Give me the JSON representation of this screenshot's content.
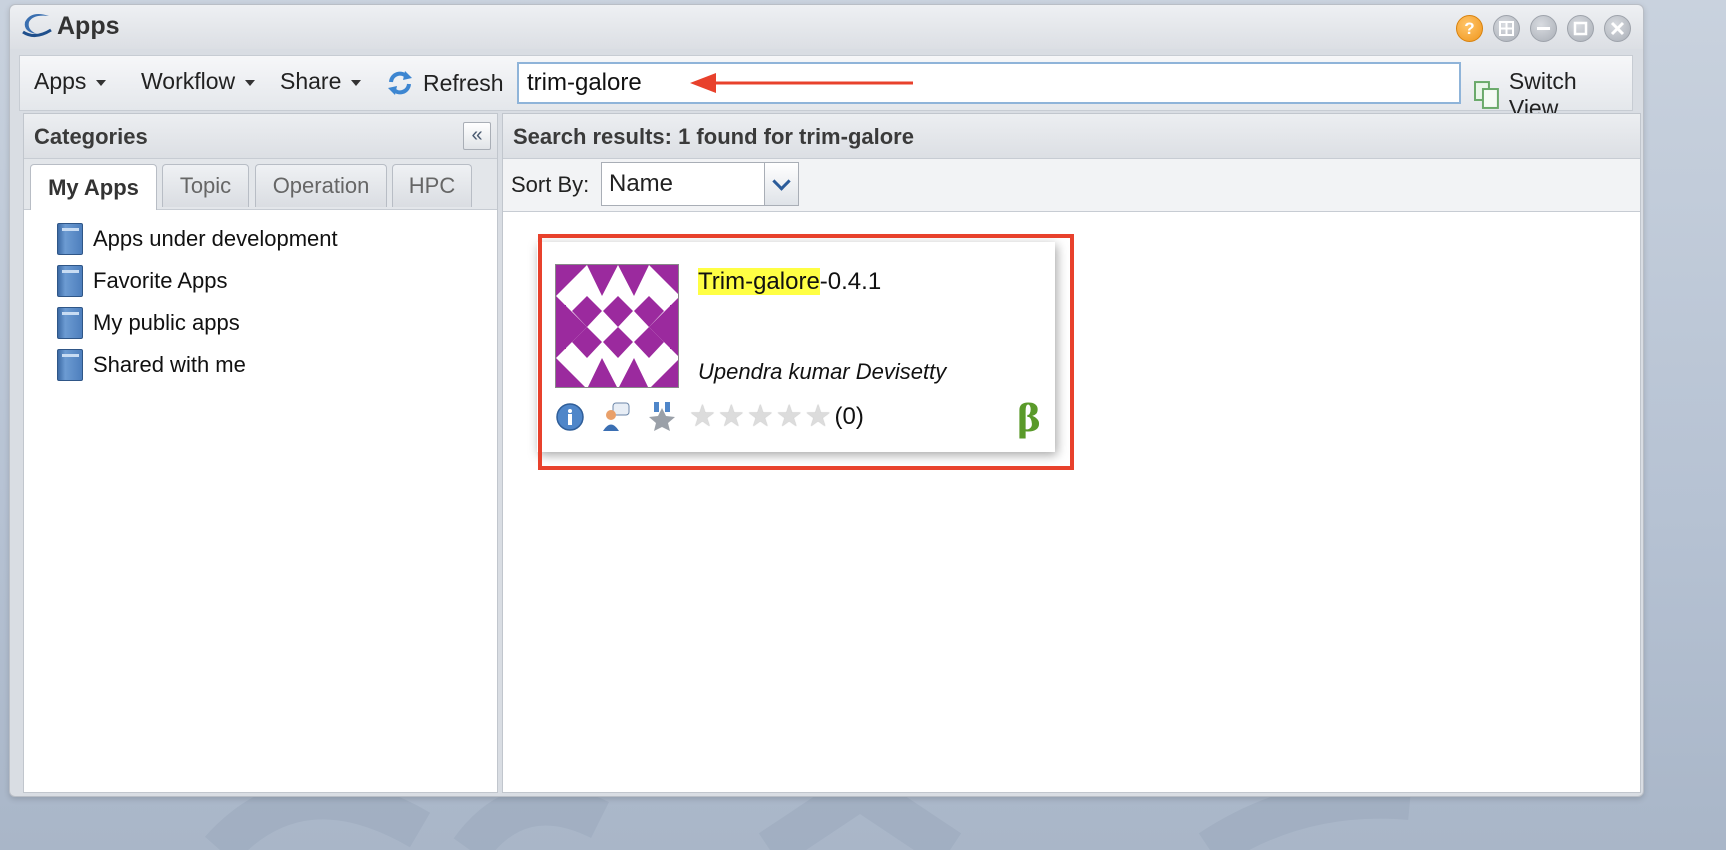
{
  "window": {
    "title": "Apps"
  },
  "toolbar": {
    "apps_label": "Apps",
    "workflow_label": "Workflow",
    "share_label": "Share",
    "refresh_label": "Refresh",
    "search_value": "trim-galore",
    "switch_view_label": "Switch View"
  },
  "categories": {
    "title": "Categories",
    "tabs": [
      {
        "label": "My Apps",
        "active": true
      },
      {
        "label": "Topic",
        "active": false
      },
      {
        "label": "Operation",
        "active": false
      },
      {
        "label": "HPC",
        "active": false
      }
    ],
    "items": [
      {
        "label": "Apps under development",
        "icon": "book-icon"
      },
      {
        "label": "Favorite Apps",
        "icon": "book-icon"
      },
      {
        "label": "My public apps",
        "icon": "book-icon"
      },
      {
        "label": "Shared with me",
        "icon": "book-icon"
      }
    ]
  },
  "results": {
    "title": "Search results: 1 found for trim-galore",
    "sort_label": "Sort By:",
    "sort_value": "Name"
  },
  "app_card": {
    "name_highlight": "Trim-galore",
    "name_rest": "-0.4.1",
    "author": "Upendra kumar Devisetty",
    "rating_count": "(0)",
    "rating": 0,
    "beta_symbol": "β"
  },
  "colors": {
    "annotation_red": "#e8412c",
    "thumbnail_purple": "#9b2a9e",
    "beta_green": "#5a9a2a",
    "highlight_yellow": "#ffff44"
  }
}
